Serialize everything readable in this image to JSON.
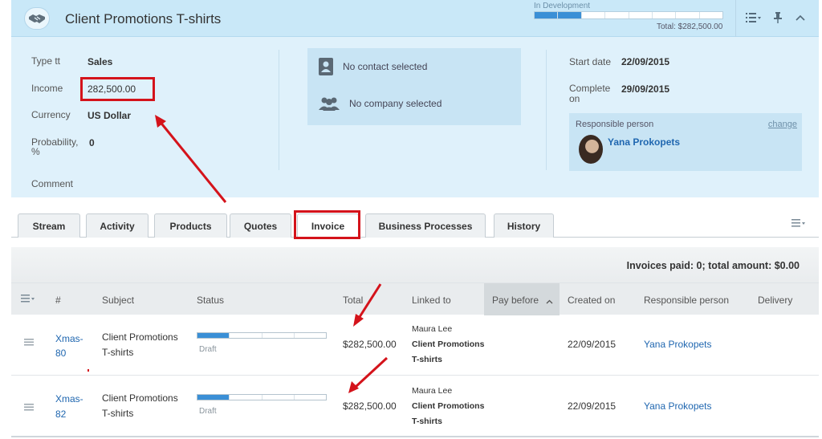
{
  "deal": {
    "title": "Client Promotions T-shirts",
    "stage": {
      "label": "In Development",
      "segments": 8,
      "filled": 2,
      "total": "Total: $282,500.00"
    },
    "fields": [
      {
        "label": "Type tt",
        "value": "Sales"
      },
      {
        "label": "Income",
        "value": "282,500.00"
      },
      {
        "label": "Currency",
        "value": "US Dollar"
      },
      {
        "label": "Probability, %",
        "value": "0"
      },
      {
        "label": "Comment",
        "value": ""
      }
    ],
    "contact": "No contact selected",
    "company": "No company selected",
    "start_date": {
      "label": "Start date",
      "value": "22/09/2015"
    },
    "complete_on": {
      "label": "Complete on",
      "value": "29/09/2015"
    },
    "responsible": {
      "label": "Responsible person",
      "change": "change",
      "name": "Yana Prokopets"
    }
  },
  "tabs": [
    "Stream",
    "Activity",
    "Products",
    "Quotes",
    "Invoice",
    "Business Processes",
    "History"
  ],
  "active_tab": "Invoice",
  "grid": {
    "summary": "Invoices paid: 0; total amount: $0.00",
    "columns": [
      "#",
      "Subject",
      "Status",
      "Total",
      "Linked to",
      "Pay before",
      "Created on",
      "Responsible person",
      "Delivery"
    ],
    "rows": [
      {
        "number_line1": "Xmas-",
        "number_line2": "80",
        "subject_line1": "Client Promotions",
        "subject_line2": "T-shirts",
        "status": "Draft",
        "status_progress": 0.25,
        "total": "$282,500.00",
        "linked_contact": "Maura Lee",
        "linked_deal_line1": "Client Promotions",
        "linked_deal_line2": "T-shirts",
        "created_on": "22/09/2015",
        "responsible": "Yana Prokopets"
      },
      {
        "number_line1": "Xmas-",
        "number_line2": "82",
        "subject_line1": "Client Promotions",
        "subject_line2": "T-shirts",
        "status": "Draft",
        "status_progress": 0.25,
        "total": "$282,500.00",
        "linked_contact": "Maura Lee",
        "linked_deal_line1": "Client Promotions",
        "linked_deal_line2": "T-shirts",
        "created_on": "22/09/2015",
        "responsible": "Yana Prokopets"
      }
    ]
  },
  "colors": {
    "accent": "#2067b0",
    "highlight": "#d4131b",
    "progress": "#3a8fd6"
  }
}
